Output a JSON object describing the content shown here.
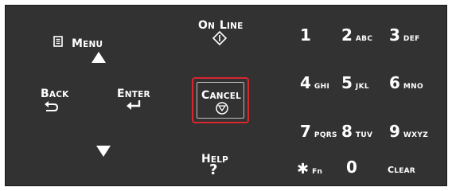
{
  "keys": {
    "menu": {
      "label_first": "M",
      "label_rest": "ENU"
    },
    "online": {
      "label_first_1": "O",
      "label_rest_1": "N",
      "label_first_2": "L",
      "label_rest_2": "INE"
    },
    "back": {
      "label_first": "B",
      "label_rest": "ACK"
    },
    "enter": {
      "label_first": "E",
      "label_rest": "NTER"
    },
    "cancel": {
      "label_first": "C",
      "label_rest": "ANCEL"
    },
    "help": {
      "label_first": "H",
      "label_rest": "ELP",
      "symbol": "?"
    },
    "clear": {
      "label_first": "C",
      "label_rest": "LEAR"
    },
    "fn": {
      "symbol": "✱",
      "label": "Fn"
    }
  },
  "numpad": [
    {
      "digit": "1",
      "letters": ""
    },
    {
      "digit": "2",
      "letters": "ABC"
    },
    {
      "digit": "3",
      "letters": "DEF"
    },
    {
      "digit": "4",
      "letters": "GHI"
    },
    {
      "digit": "5",
      "letters": "JKL"
    },
    {
      "digit": "6",
      "letters": "MNO"
    },
    {
      "digit": "7",
      "letters": "PQRS"
    },
    {
      "digit": "8",
      "letters": "TUV"
    },
    {
      "digit": "9",
      "letters": "WXYZ"
    },
    {
      "digit": "0",
      "letters": ""
    }
  ],
  "colors": {
    "panel": "#323232",
    "highlight": "#d8262f",
    "text": "#ffffff"
  }
}
